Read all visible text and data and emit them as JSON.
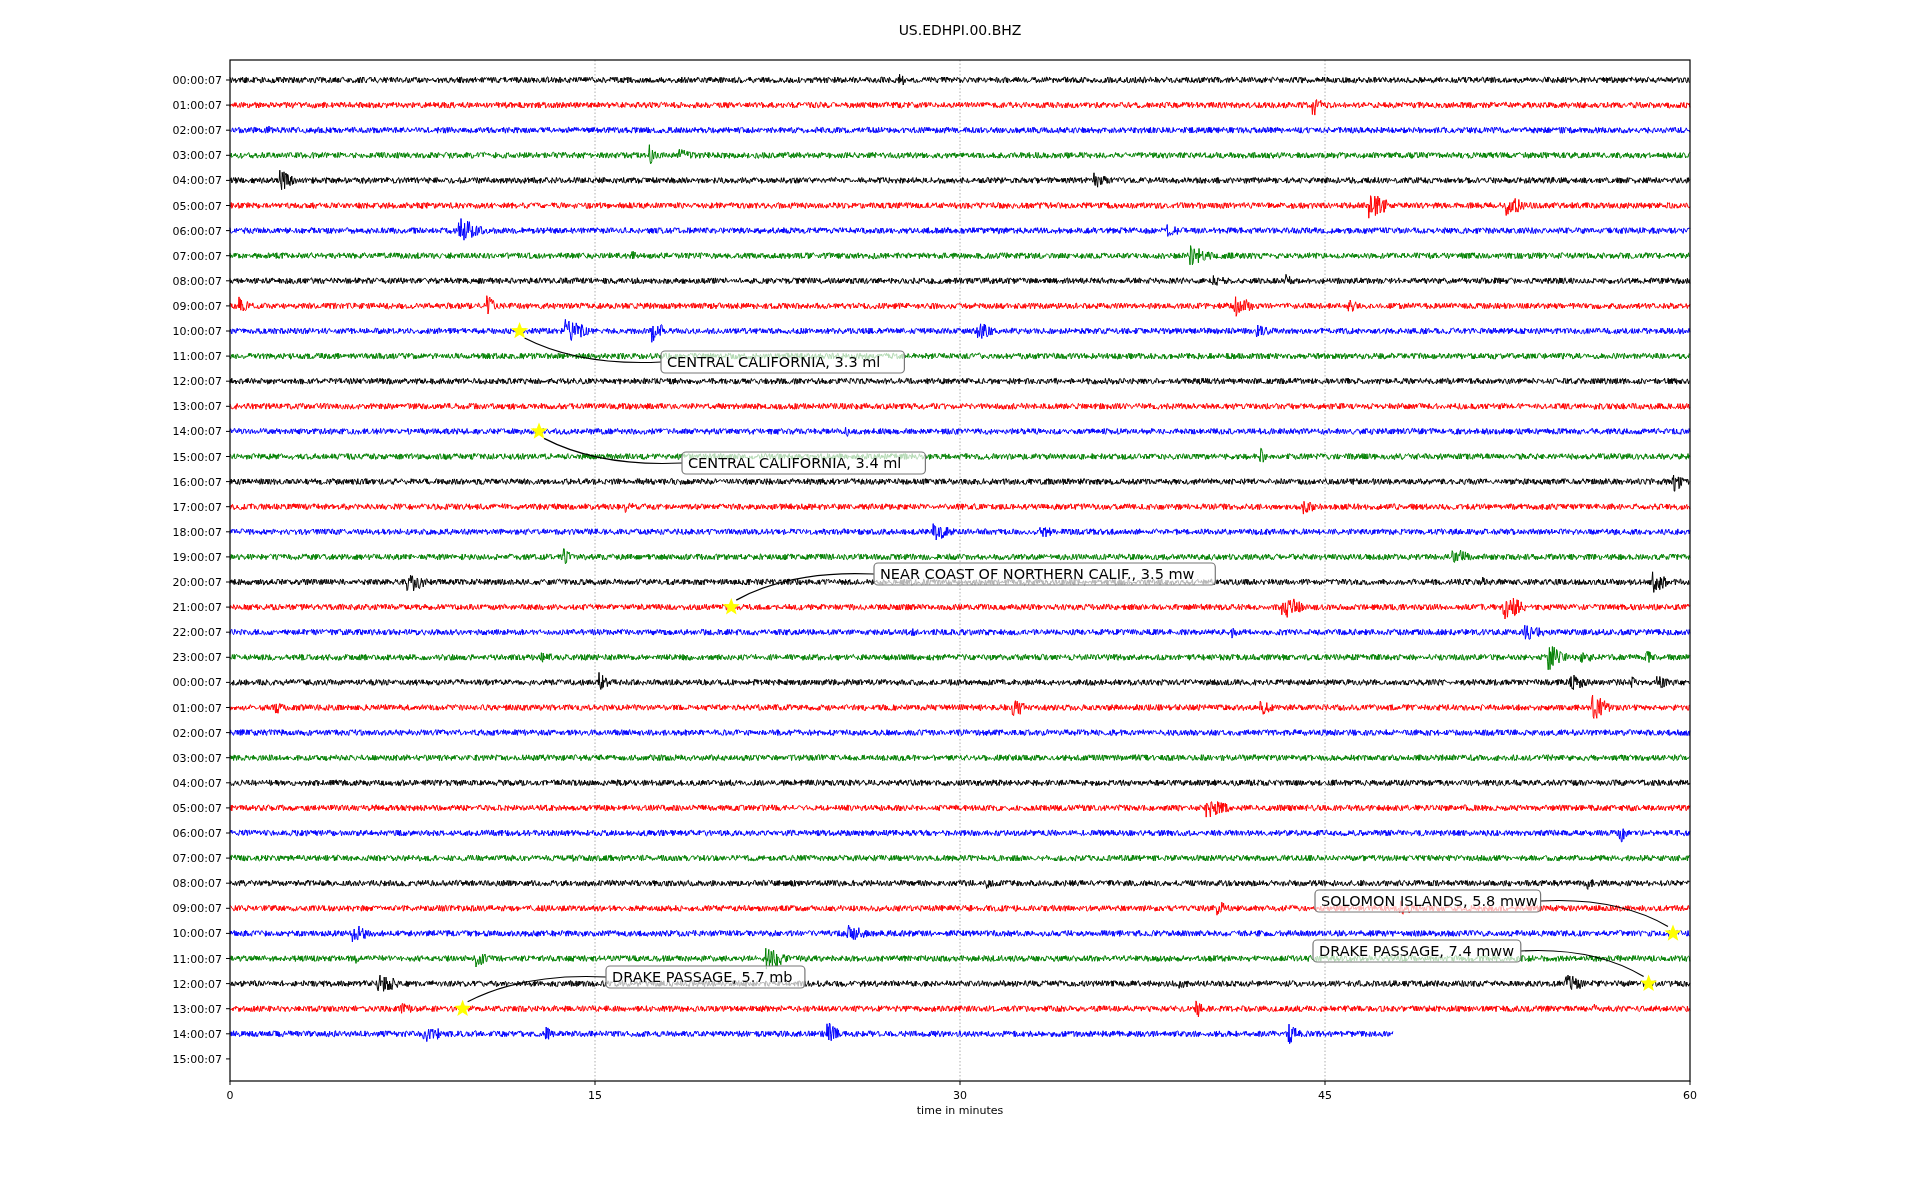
{
  "plot": {
    "title": "US.EDHPI.00.BHZ",
    "xlabel": "time in minutes",
    "xticks": [
      "0",
      "15",
      "30",
      "45",
      "60"
    ],
    "rows": [
      {
        "label": "00:00:07",
        "color": "#000000"
      },
      {
        "label": "01:00:07",
        "color": "#ff0000"
      },
      {
        "label": "02:00:07",
        "color": "#0000ff"
      },
      {
        "label": "03:00:07",
        "color": "#008000"
      },
      {
        "label": "04:00:07",
        "color": "#000000"
      },
      {
        "label": "05:00:07",
        "color": "#ff0000"
      },
      {
        "label": "06:00:07",
        "color": "#0000ff"
      },
      {
        "label": "07:00:07",
        "color": "#008000"
      },
      {
        "label": "08:00:07",
        "color": "#000000"
      },
      {
        "label": "09:00:07",
        "color": "#ff0000"
      },
      {
        "label": "10:00:07",
        "color": "#0000ff"
      },
      {
        "label": "11:00:07",
        "color": "#008000"
      },
      {
        "label": "12:00:07",
        "color": "#000000"
      },
      {
        "label": "13:00:07",
        "color": "#ff0000"
      },
      {
        "label": "14:00:07",
        "color": "#0000ff"
      },
      {
        "label": "15:00:07",
        "color": "#008000"
      },
      {
        "label": "16:00:07",
        "color": "#000000"
      },
      {
        "label": "17:00:07",
        "color": "#ff0000"
      },
      {
        "label": "18:00:07",
        "color": "#0000ff"
      },
      {
        "label": "19:00:07",
        "color": "#008000"
      },
      {
        "label": "20:00:07",
        "color": "#000000"
      },
      {
        "label": "21:00:07",
        "color": "#ff0000"
      },
      {
        "label": "22:00:07",
        "color": "#0000ff"
      },
      {
        "label": "23:00:07",
        "color": "#008000"
      },
      {
        "label": "00:00:07",
        "color": "#000000"
      },
      {
        "label": "01:00:07",
        "color": "#ff0000"
      },
      {
        "label": "02:00:07",
        "color": "#0000ff"
      },
      {
        "label": "03:00:07",
        "color": "#008000"
      },
      {
        "label": "04:00:07",
        "color": "#000000"
      },
      {
        "label": "05:00:07",
        "color": "#ff0000"
      },
      {
        "label": "06:00:07",
        "color": "#0000ff"
      },
      {
        "label": "07:00:07",
        "color": "#008000"
      },
      {
        "label": "08:00:07",
        "color": "#000000"
      },
      {
        "label": "09:00:07",
        "color": "#ff0000"
      },
      {
        "label": "10:00:07",
        "color": "#0000ff"
      },
      {
        "label": "11:00:07",
        "color": "#008000"
      },
      {
        "label": "12:00:07",
        "color": "#000000"
      },
      {
        "label": "13:00:07",
        "color": "#ff0000"
      },
      {
        "label": "14:00:07",
        "color": "#0000ff"
      },
      {
        "label": "15:00:07"
      }
    ],
    "annotations": [
      "CENTRAL CALIFORNIA, 3.3 ml",
      "CENTRAL CALIFORNIA, 3.4 ml",
      "NEAR COAST OF NORTHERN CALIF., 3.5 mw",
      "SOLOMON ISLANDS, 5.8 mww",
      "DRAKE PASSAGE, 7.4 mww",
      "DRAKE PASSAGE, 5.7 mb"
    ]
  }
}
